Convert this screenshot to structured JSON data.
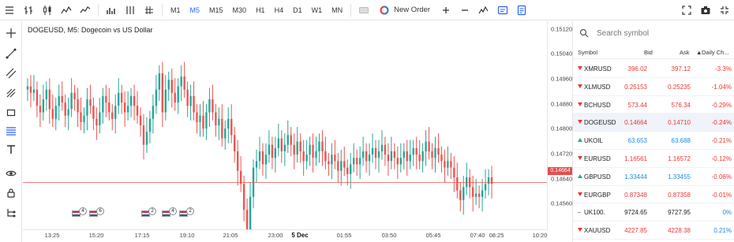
{
  "toolbar": {
    "timeframes": [
      "M1",
      "M5",
      "M15",
      "M30",
      "H1",
      "H4",
      "D1",
      "W1",
      "MN"
    ],
    "active_timeframe": "M5",
    "new_order_label": "New Order"
  },
  "chart": {
    "symbol_title": "DOGEUSD, M5: Dogecoin vs US Dollar",
    "price_labels": [
      "0.15120",
      "0.15040",
      "0.14960",
      "0.14880",
      "0.14800",
      "0.14720",
      "0.14640",
      "0.14560"
    ],
    "current_price": "0.14664",
    "time_labels": [
      "13:25",
      "15:20",
      "17:15",
      "19:10",
      "21:05",
      "23:00",
      "5 Dec",
      "01:55",
      "03:50",
      "05:45",
      "07:40",
      "08:25",
      "10:20"
    ],
    "event_counts": [
      "4",
      "6",
      "2",
      "4",
      "2"
    ],
    "colors": {
      "bull": "#26a69a",
      "bear": "#ef5350",
      "price_line": "#ef5350"
    }
  },
  "chart_data": {
    "type": "candlestick",
    "title": "DOGEUSD, M5: Dogecoin vs US Dollar",
    "ylim": [
      0.1452,
      0.1516
    ],
    "close_series": [
      0.1496,
      0.1494,
      0.1495,
      0.149,
      0.1488,
      0.1492,
      0.1495,
      0.1489,
      0.1486,
      0.149,
      0.1493,
      0.1491,
      0.1487,
      0.1489,
      0.1494,
      0.1492,
      0.1488,
      0.1485,
      0.1487,
      0.1492,
      0.149,
      0.1486,
      0.1484,
      0.1488,
      0.1493,
      0.1491,
      0.1488,
      0.1486,
      0.149,
      0.1494,
      0.1491,
      0.1488,
      0.149,
      0.1493,
      0.149,
      0.1487,
      0.1484,
      0.1478,
      0.1482,
      0.1486,
      0.149,
      0.1495,
      0.15,
      0.1488,
      0.1495,
      0.1498,
      0.1494,
      0.1491,
      0.1496,
      0.1499,
      0.1495,
      0.149,
      0.1493,
      0.1488,
      0.1485,
      0.1487,
      0.1483,
      0.1488,
      0.1492,
      0.1488,
      0.1484,
      0.1486,
      0.148,
      0.1483,
      0.1486,
      0.1481,
      0.1476,
      0.147,
      0.1466,
      0.1458,
      0.1452,
      0.1462,
      0.1471,
      0.1473,
      0.1476,
      0.1472,
      0.1475,
      0.1478,
      0.1474,
      0.1477,
      0.148,
      0.1476,
      0.1478,
      0.1481,
      0.1478,
      0.1475,
      0.1479,
      0.1476,
      0.1473,
      0.1475,
      0.1478,
      0.1474,
      0.1476,
      0.1479,
      0.1476,
      0.1473,
      0.1472,
      0.1475,
      0.1473,
      0.147,
      0.1473,
      0.1471,
      0.1469,
      0.1472,
      0.1474,
      0.1472,
      0.1474,
      0.1476,
      0.1473,
      0.1475,
      0.1477,
      0.1474,
      0.1476,
      0.1478,
      0.1475,
      0.1473,
      0.1476,
      0.1474,
      0.1472,
      0.1474,
      0.1476,
      0.1473,
      0.1475,
      0.1477,
      0.1475,
      0.1473,
      0.1476,
      0.1479,
      0.1476,
      0.1474,
      0.1477,
      0.1475,
      0.1473,
      0.1471,
      0.1473,
      0.1471,
      0.1468,
      0.1464,
      0.1461,
      0.1465,
      0.1468,
      0.1465,
      0.1462,
      0.1463,
      0.1462,
      0.1464,
      0.1466,
      0.1468,
      0.1466
    ]
  },
  "watchlist": {
    "search_placeholder": "Search symbol",
    "headers": {
      "symbol": "Symbol",
      "bid": "Bid",
      "ask": "Ask",
      "change": "Daily Ch..."
    },
    "rows": [
      {
        "symbol": "XMRUSD",
        "bid": "396.02",
        "ask": "397.12",
        "change": "-3.3%",
        "dir": "dn"
      },
      {
        "symbol": "XLMUSD",
        "bid": "0.25153",
        "ask": "0.25235",
        "change": "-1.04%",
        "dir": "dn"
      },
      {
        "symbol": "BCHUSD",
        "bid": "573.44",
        "ask": "576.34",
        "change": "-0.29%",
        "dir": "dn"
      },
      {
        "symbol": "DOGEUSD",
        "bid": "0.14664",
        "ask": "0.14710",
        "change": "-0.24%",
        "dir": "dn"
      },
      {
        "symbol": "UKOIL",
        "bid": "63.653",
        "ask": "63.688",
        "change": "-0.21%",
        "dir": "up"
      },
      {
        "symbol": "EURUSD",
        "bid": "1.16561",
        "ask": "1.16572",
        "change": "-0.12%",
        "dir": "dn"
      },
      {
        "symbol": "GBPUSD",
        "bid": "1.33444",
        "ask": "1.33455",
        "change": "-0.06%",
        "dir": "up"
      },
      {
        "symbol": "EURGBP",
        "bid": "0.87348",
        "ask": "0.87358",
        "change": "-0.01%",
        "dir": "dn"
      },
      {
        "symbol": "UK100.",
        "bid": "9724.65",
        "ask": "9727.95",
        "change": "0%",
        "dir": "dot"
      },
      {
        "symbol": "XAUUSD",
        "bid": "4227.85",
        "ask": "4228.38",
        "change": "0.21%",
        "dir": "dn"
      }
    ]
  }
}
